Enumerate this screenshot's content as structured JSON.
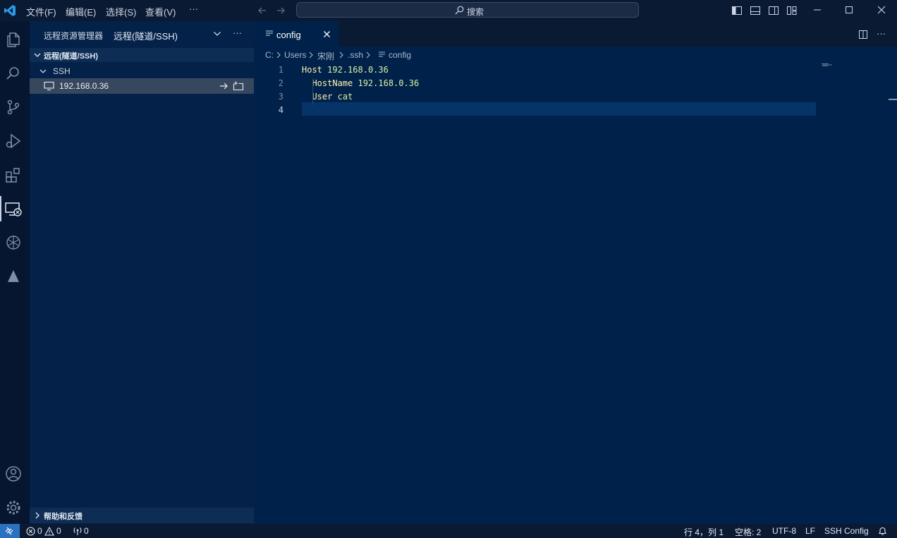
{
  "titlebar": {
    "menus": [
      "文件(F)",
      "编辑(E)",
      "选择(S)",
      "查看(V)"
    ],
    "more": "···",
    "search_placeholder": "搜索"
  },
  "sidebar": {
    "title": "远程资源管理器",
    "dropdown_value": "远程(隧道/SSH)",
    "more": "···",
    "section_title": "远程(隧道/SSH)",
    "group": "SSH",
    "host": "192.168.0.36",
    "help_section": "帮助和反馈"
  },
  "editor": {
    "tab": {
      "label": "config"
    },
    "breadcrumb": [
      "C:",
      "Users",
      "宋刚",
      ".ssh",
      "config"
    ],
    "line_numbers": [
      "1",
      "2",
      "3",
      "4"
    ],
    "lines": [
      {
        "key": "Host",
        "value": "192.168.0.36",
        "indent": ""
      },
      {
        "key": "HostName",
        "value": "192.168.0.36",
        "indent": "  "
      },
      {
        "key": "User",
        "value": "cat",
        "indent": "  "
      },
      {
        "key": "",
        "value": "",
        "indent": ""
      }
    ]
  },
  "statusbar": {
    "errors": "0",
    "warnings": "0",
    "ports": "0",
    "position": "行 4，列 1",
    "spaces": "空格: 2",
    "encoding": "UTF-8",
    "eol": "LF",
    "language": "SSH Config"
  },
  "colors": {
    "editor_bg": "#00224a",
    "sidebar_bg": "#042149",
    "titlebar_bg": "#0b1a33",
    "accent": "#2a72c0",
    "selected_row": "#37475e"
  }
}
